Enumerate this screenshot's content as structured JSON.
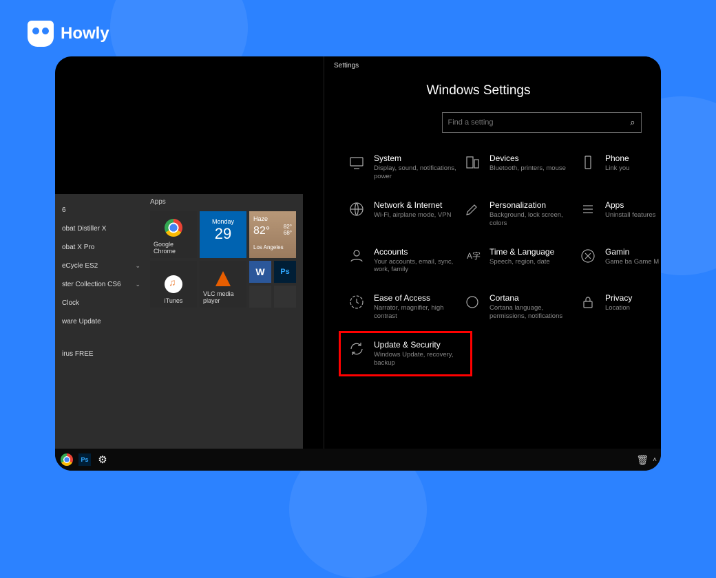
{
  "brand": {
    "name": "Howly"
  },
  "start_menu": {
    "apps_label": "Apps",
    "list_items": [
      {
        "label": "6",
        "expand": false
      },
      {
        "label": "obat Distiller X",
        "expand": false
      },
      {
        "label": "obat X Pro",
        "expand": false
      },
      {
        "label": "eCycle ES2",
        "expand": true
      },
      {
        "label": "ster Collection CS6",
        "expand": true
      },
      {
        "label": "Clock",
        "expand": false
      },
      {
        "label": "ware Update",
        "expand": false
      },
      {
        "label": "irus FREE",
        "expand": false
      }
    ],
    "tiles": {
      "chrome": "Google Chrome",
      "calendar_day": "Monday",
      "calendar_num": "29",
      "weather_cond": "Haze",
      "weather_temp": "82°",
      "weather_hi": "82°",
      "weather_lo": "68°",
      "weather_city": "Los Angeles",
      "itunes": "iTunes",
      "vlc": "VLC media player",
      "word": "W",
      "ps": "Ps"
    }
  },
  "settings": {
    "caption": "Settings",
    "title": "Windows Settings",
    "search_placeholder": "Find a setting",
    "items": [
      {
        "title": "System",
        "desc": "Display, sound, notifications, power"
      },
      {
        "title": "Devices",
        "desc": "Bluetooth, printers, mouse"
      },
      {
        "title": "Phone",
        "desc": "Link you"
      },
      {
        "title": "Network & Internet",
        "desc": "Wi-Fi, airplane mode, VPN"
      },
      {
        "title": "Personalization",
        "desc": "Background, lock screen, colors"
      },
      {
        "title": "Apps",
        "desc": "Uninstall features"
      },
      {
        "title": "Accounts",
        "desc": "Your accounts, email, sync, work, family"
      },
      {
        "title": "Time & Language",
        "desc": "Speech, region, date"
      },
      {
        "title": "Gamin",
        "desc": "Game ba Game M"
      },
      {
        "title": "Ease of Access",
        "desc": "Narrator, magnifier, high contrast"
      },
      {
        "title": "Cortana",
        "desc": "Cortana language, permissions, notifications"
      },
      {
        "title": "Privacy",
        "desc": "Location"
      },
      {
        "title": "Update & Security",
        "desc": "Windows Update, recovery, backup"
      }
    ]
  },
  "taskbar": {
    "ps": "Ps",
    "chevron": "˄"
  }
}
